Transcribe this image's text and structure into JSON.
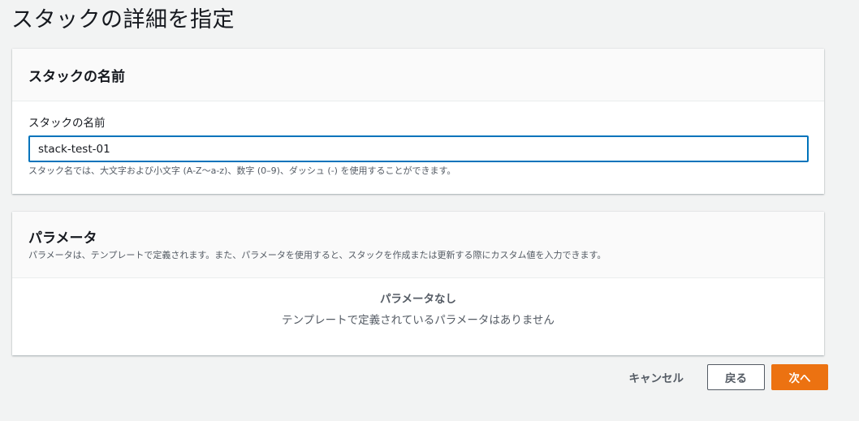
{
  "page": {
    "title": "スタックの詳細を指定"
  },
  "stack_name_panel": {
    "header": "スタックの名前",
    "field_label": "スタックの名前",
    "field_value": "stack-test-01",
    "field_hint": "スタック名では、大文字および小文字 (A-Z〜a-z)、数字 (0–9)、ダッシュ (-) を使用することができます。"
  },
  "params_panel": {
    "header": "パラメータ",
    "description": "パラメータは、テンプレートで定義されます。また、パラメータを使用すると、スタックを作成または更新する際にカスタム値を入力できます。",
    "empty_title": "パラメータなし",
    "empty_desc": "テンプレートで定義されているパラメータはありません"
  },
  "actions": {
    "cancel_label": "キャンセル",
    "back_label": "戻る",
    "next_label": "次へ"
  },
  "colors": {
    "primary": "#ec7211",
    "focus": "#0073bb",
    "background": "#f2f3f3"
  }
}
